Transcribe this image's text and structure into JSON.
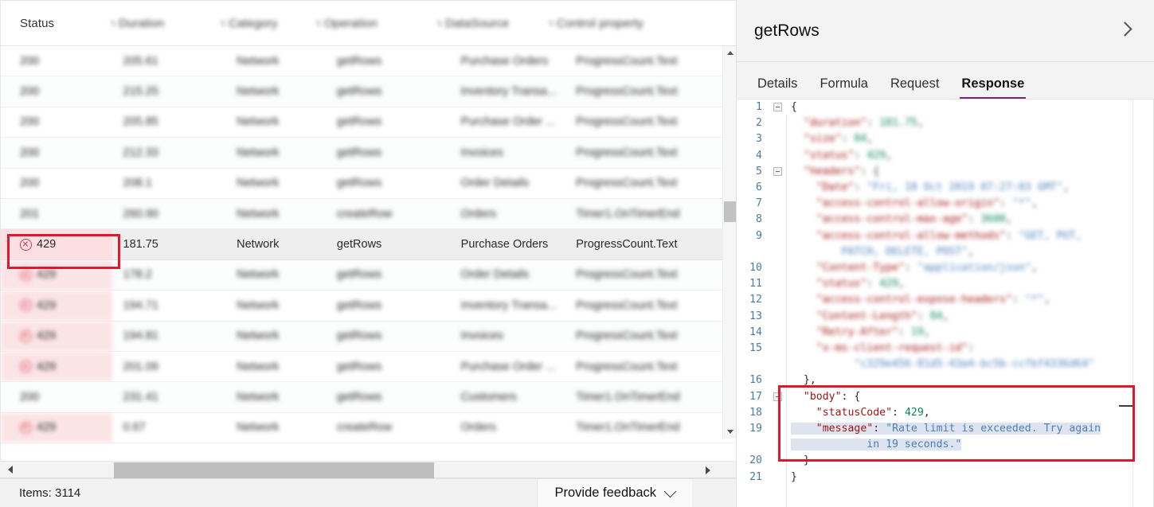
{
  "table": {
    "columns": [
      {
        "id": "status",
        "label": "Status",
        "blurred": false
      },
      {
        "id": "duration",
        "label": "Duration",
        "blurred": true
      },
      {
        "id": "category",
        "label": "Category",
        "blurred": true
      },
      {
        "id": "operation",
        "label": "Operation",
        "blurred": true
      },
      {
        "id": "datasource",
        "label": "DataSource",
        "blurred": true
      },
      {
        "id": "control",
        "label": "Control property",
        "blurred": true
      }
    ],
    "rows": [
      {
        "status": "200",
        "duration": "205.61",
        "category": "Network",
        "operation": "getRows",
        "datasource": "Purchase Orders",
        "control": "ProgressCount.Text",
        "error": false,
        "selected": false,
        "blurred": true
      },
      {
        "status": "200",
        "duration": "215.25",
        "category": "Network",
        "operation": "getRows",
        "datasource": "Inventory Transa...",
        "control": "ProgressCount.Text",
        "error": false,
        "selected": false,
        "blurred": true
      },
      {
        "status": "200",
        "duration": "205.85",
        "category": "Network",
        "operation": "getRows",
        "datasource": "Purchase Order ...",
        "control": "ProgressCount.Text",
        "error": false,
        "selected": false,
        "blurred": true
      },
      {
        "status": "200",
        "duration": "212.33",
        "category": "Network",
        "operation": "getRows",
        "datasource": "Invoices",
        "control": "ProgressCount.Text",
        "error": false,
        "selected": false,
        "blurred": true
      },
      {
        "status": "200",
        "duration": "208.1",
        "category": "Network",
        "operation": "getRows",
        "datasource": "Order Details",
        "control": "ProgressCount.Text",
        "error": false,
        "selected": false,
        "blurred": true
      },
      {
        "status": "201",
        "duration": "260.90",
        "category": "Network",
        "operation": "createRow",
        "datasource": "Orders",
        "control": "Timer1.OnTimerEnd",
        "error": false,
        "selected": false,
        "blurred": true
      },
      {
        "status": "429",
        "duration": "181.75",
        "category": "Network",
        "operation": "getRows",
        "datasource": "Purchase Orders",
        "control": "ProgressCount.Text",
        "error": true,
        "selected": true,
        "blurred": false
      },
      {
        "status": "429",
        "duration": "178.2",
        "category": "Network",
        "operation": "getRows",
        "datasource": "Order Details",
        "control": "ProgressCount.Text",
        "error": true,
        "selected": false,
        "blurred": true
      },
      {
        "status": "429",
        "duration": "194.71",
        "category": "Network",
        "operation": "getRows",
        "datasource": "Inventory Transa...",
        "control": "ProgressCount.Text",
        "error": true,
        "selected": false,
        "blurred": true
      },
      {
        "status": "429",
        "duration": "194.81",
        "category": "Network",
        "operation": "getRows",
        "datasource": "Invoices",
        "control": "ProgressCount.Text",
        "error": true,
        "selected": false,
        "blurred": true
      },
      {
        "status": "429",
        "duration": "201.09",
        "category": "Network",
        "operation": "getRows",
        "datasource": "Purchase Order ...",
        "control": "ProgressCount.Text",
        "error": true,
        "selected": false,
        "blurred": true
      },
      {
        "status": "200",
        "duration": "231.41",
        "category": "Network",
        "operation": "getRows",
        "datasource": "Customers",
        "control": "Timer1.OnTimerEnd",
        "error": false,
        "selected": false,
        "blurred": true
      },
      {
        "status": "429",
        "duration": "0.67",
        "category": "Network",
        "operation": "createRow",
        "datasource": "Orders",
        "control": "Timer1.OnTimerEnd",
        "error": true,
        "selected": false,
        "blurred": true
      }
    ],
    "error_icon": "circle-x-icon",
    "callout_color": "#e0182d"
  },
  "statusbar": {
    "items_label": "Items: 3114",
    "feedback_label": "Provide feedback"
  },
  "scrollbars": {
    "v_up": "scroll-up-arrow",
    "v_down": "scroll-down-arrow",
    "h_left": "scroll-left-arrow",
    "h_right": "scroll-right-arrow"
  },
  "details": {
    "title": "getRows",
    "collapse_icon": "chevron-right-icon",
    "tabs": [
      {
        "label": "Details",
        "active": false
      },
      {
        "label": "Formula",
        "active": false
      },
      {
        "label": "Request",
        "active": false
      },
      {
        "label": "Response",
        "active": true
      }
    ],
    "active_tab_color": "#742774",
    "code": [
      {
        "n": "1",
        "fold": true,
        "blurred": false,
        "indent": 0,
        "parts": [
          {
            "t": "{",
            "c": "pun"
          }
        ]
      },
      {
        "n": "2",
        "fold": false,
        "blurred": true,
        "indent": 1,
        "parts": [
          {
            "t": "\"duration\"",
            "c": "k"
          },
          {
            "t": ": ",
            "c": "pun"
          },
          {
            "t": "181.75",
            "c": "num"
          },
          {
            "t": ",",
            "c": "pun"
          }
        ]
      },
      {
        "n": "3",
        "fold": false,
        "blurred": true,
        "indent": 1,
        "parts": [
          {
            "t": "\"size\"",
            "c": "k"
          },
          {
            "t": ": ",
            "c": "pun"
          },
          {
            "t": "84",
            "c": "num"
          },
          {
            "t": ",",
            "c": "pun"
          }
        ]
      },
      {
        "n": "4",
        "fold": false,
        "blurred": true,
        "indent": 1,
        "parts": [
          {
            "t": "\"status\"",
            "c": "k"
          },
          {
            "t": ": ",
            "c": "pun"
          },
          {
            "t": "429",
            "c": "num"
          },
          {
            "t": ",",
            "c": "pun"
          }
        ]
      },
      {
        "n": "5",
        "fold": true,
        "blurred": true,
        "indent": 1,
        "parts": [
          {
            "t": "\"headers\"",
            "c": "k"
          },
          {
            "t": ": {",
            "c": "pun"
          }
        ]
      },
      {
        "n": "6",
        "fold": false,
        "blurred": true,
        "indent": 2,
        "parts": [
          {
            "t": "\"Date\"",
            "c": "k"
          },
          {
            "t": ": ",
            "c": "pun"
          },
          {
            "t": "\"Fri, 18 Oct 2019 07:27:03 GMT\"",
            "c": "str"
          },
          {
            "t": ",",
            "c": "pun"
          }
        ]
      },
      {
        "n": "7",
        "fold": false,
        "blurred": true,
        "indent": 2,
        "parts": [
          {
            "t": "\"access-control-allow-origin\"",
            "c": "k"
          },
          {
            "t": ": ",
            "c": "pun"
          },
          {
            "t": "\"*\"",
            "c": "str"
          },
          {
            "t": ",",
            "c": "pun"
          }
        ]
      },
      {
        "n": "8",
        "fold": false,
        "blurred": true,
        "indent": 2,
        "parts": [
          {
            "t": "\"access-control-max-age\"",
            "c": "k"
          },
          {
            "t": ": ",
            "c": "pun"
          },
          {
            "t": "3600",
            "c": "num"
          },
          {
            "t": ",",
            "c": "pun"
          }
        ]
      },
      {
        "n": "9",
        "fold": false,
        "blurred": true,
        "indent": 2,
        "parts": [
          {
            "t": "\"access-control-allow-methods\"",
            "c": "k"
          },
          {
            "t": ": ",
            "c": "pun"
          },
          {
            "t": "\"GET, PUT,",
            "c": "str"
          }
        ]
      },
      {
        "n": "",
        "fold": false,
        "blurred": true,
        "indent": 4,
        "parts": [
          {
            "t": "PATCH, DELETE, POST\"",
            "c": "str"
          },
          {
            "t": ",",
            "c": "pun"
          }
        ]
      },
      {
        "n": "10",
        "fold": false,
        "blurred": true,
        "indent": 2,
        "parts": [
          {
            "t": "\"Content-Type\"",
            "c": "k"
          },
          {
            "t": ": ",
            "c": "pun"
          },
          {
            "t": "\"application/json\"",
            "c": "str"
          },
          {
            "t": ",",
            "c": "pun"
          }
        ]
      },
      {
        "n": "11",
        "fold": false,
        "blurred": true,
        "indent": 2,
        "parts": [
          {
            "t": "\"status\"",
            "c": "k"
          },
          {
            "t": ": ",
            "c": "pun"
          },
          {
            "t": "429",
            "c": "num"
          },
          {
            "t": ",",
            "c": "pun"
          }
        ]
      },
      {
        "n": "12",
        "fold": false,
        "blurred": true,
        "indent": 2,
        "parts": [
          {
            "t": "\"access-control-expose-headers\"",
            "c": "k"
          },
          {
            "t": ": ",
            "c": "pun"
          },
          {
            "t": "\"*\"",
            "c": "str"
          },
          {
            "t": ",",
            "c": "pun"
          }
        ]
      },
      {
        "n": "13",
        "fold": false,
        "blurred": true,
        "indent": 2,
        "parts": [
          {
            "t": "\"Content-Length\"",
            "c": "k"
          },
          {
            "t": ": ",
            "c": "pun"
          },
          {
            "t": "84",
            "c": "num"
          },
          {
            "t": ",",
            "c": "pun"
          }
        ]
      },
      {
        "n": "14",
        "fold": false,
        "blurred": true,
        "indent": 2,
        "parts": [
          {
            "t": "\"Retry-After\"",
            "c": "k"
          },
          {
            "t": ": ",
            "c": "pun"
          },
          {
            "t": "19",
            "c": "num"
          },
          {
            "t": ",",
            "c": "pun"
          }
        ]
      },
      {
        "n": "15",
        "fold": false,
        "blurred": true,
        "indent": 2,
        "parts": [
          {
            "t": "\"x-ms-client-request-id\"",
            "c": "k"
          },
          {
            "t": ":",
            "c": "pun"
          }
        ]
      },
      {
        "n": "",
        "fold": false,
        "blurred": true,
        "indent": 5,
        "parts": [
          {
            "t": "\"c329e456-81d5-43a4-bc5b-ccfbf4336d64\"",
            "c": "str"
          }
        ]
      },
      {
        "n": "16",
        "fold": false,
        "blurred": false,
        "indent": 1,
        "parts": [
          {
            "t": "},",
            "c": "pun"
          }
        ]
      },
      {
        "n": "17",
        "fold": true,
        "blurred": false,
        "indent": 1,
        "parts": [
          {
            "t": "\"body\"",
            "c": "k"
          },
          {
            "t": ": {",
            "c": "pun"
          }
        ]
      },
      {
        "n": "18",
        "fold": false,
        "blurred": false,
        "indent": 2,
        "parts": [
          {
            "t": "\"statusCode\"",
            "c": "k"
          },
          {
            "t": ": ",
            "c": "pun"
          },
          {
            "t": "429",
            "c": "num"
          },
          {
            "t": ",",
            "c": "pun"
          }
        ]
      },
      {
        "n": "19",
        "fold": false,
        "blurred": false,
        "indent": 2,
        "selected": true,
        "parts": [
          {
            "t": "\"message\"",
            "c": "k"
          },
          {
            "t": ": ",
            "c": "pun"
          },
          {
            "t": "\"Rate limit is exceeded. Try again",
            "c": "str"
          }
        ]
      },
      {
        "n": "",
        "fold": false,
        "blurred": false,
        "indent": 6,
        "selected": true,
        "parts": [
          {
            "t": "in 19 seconds.\"",
            "c": "str"
          }
        ]
      },
      {
        "n": "20",
        "fold": false,
        "blurred": false,
        "indent": 1,
        "parts": [
          {
            "t": "}",
            "c": "pun"
          }
        ]
      },
      {
        "n": "21",
        "fold": false,
        "blurred": false,
        "indent": 0,
        "parts": [
          {
            "t": "}",
            "c": "pun"
          }
        ]
      }
    ]
  }
}
